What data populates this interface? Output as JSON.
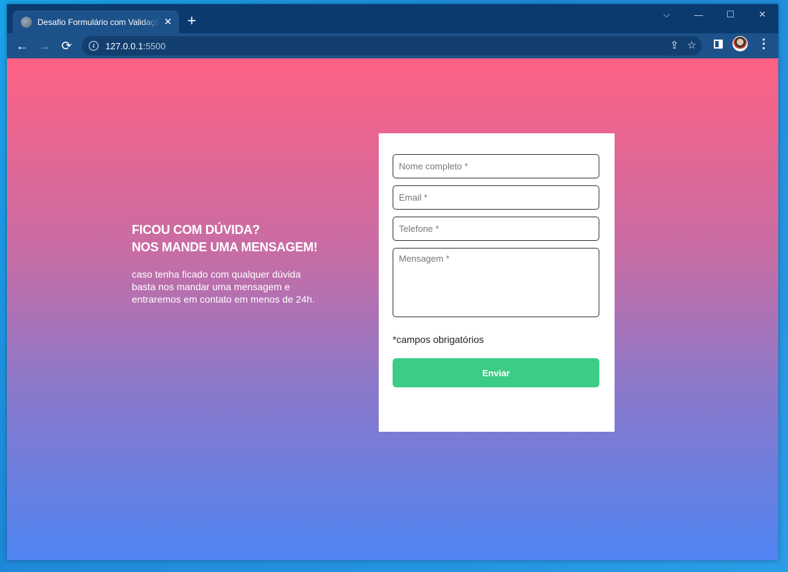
{
  "browser": {
    "tab_title": "Desafio Formulário com Validação",
    "tab_close": "✕",
    "new_tab": "+",
    "url_host": "127.0.0.1:",
    "url_port": "5500",
    "controls": {
      "collapse": "⌵",
      "minimize": "—",
      "maximize": "☐",
      "close": "✕"
    },
    "nav": {
      "back": "←",
      "forward": "→",
      "reload": "⟳"
    },
    "icons": {
      "share": "⇪",
      "bookmark": "☆",
      "menu": "⋮"
    }
  },
  "contact": {
    "heading_line1": "FICOU COM DÚVIDA?",
    "heading_line2": "NOS MANDE UMA MENSAGEM!",
    "desc_line1": "caso tenha ficado com qualquer dúvida",
    "desc_line2": "basta nos mandar uma mensagem e",
    "desc_line3": "entraremos em contato em menos de 24h."
  },
  "form": {
    "name_placeholder": "Nome completo *",
    "email_placeholder": "Email *",
    "phone_placeholder": "Telefone *",
    "message_placeholder": "Mensagem *",
    "required_note": "*campos obrigatórios",
    "submit_label": "Enviar"
  },
  "colors": {
    "gradient_top": "#fe6183",
    "gradient_bottom": "#4f84f2",
    "submit_button": "#3dcc86",
    "browser_frame": "#0b3a6e"
  }
}
